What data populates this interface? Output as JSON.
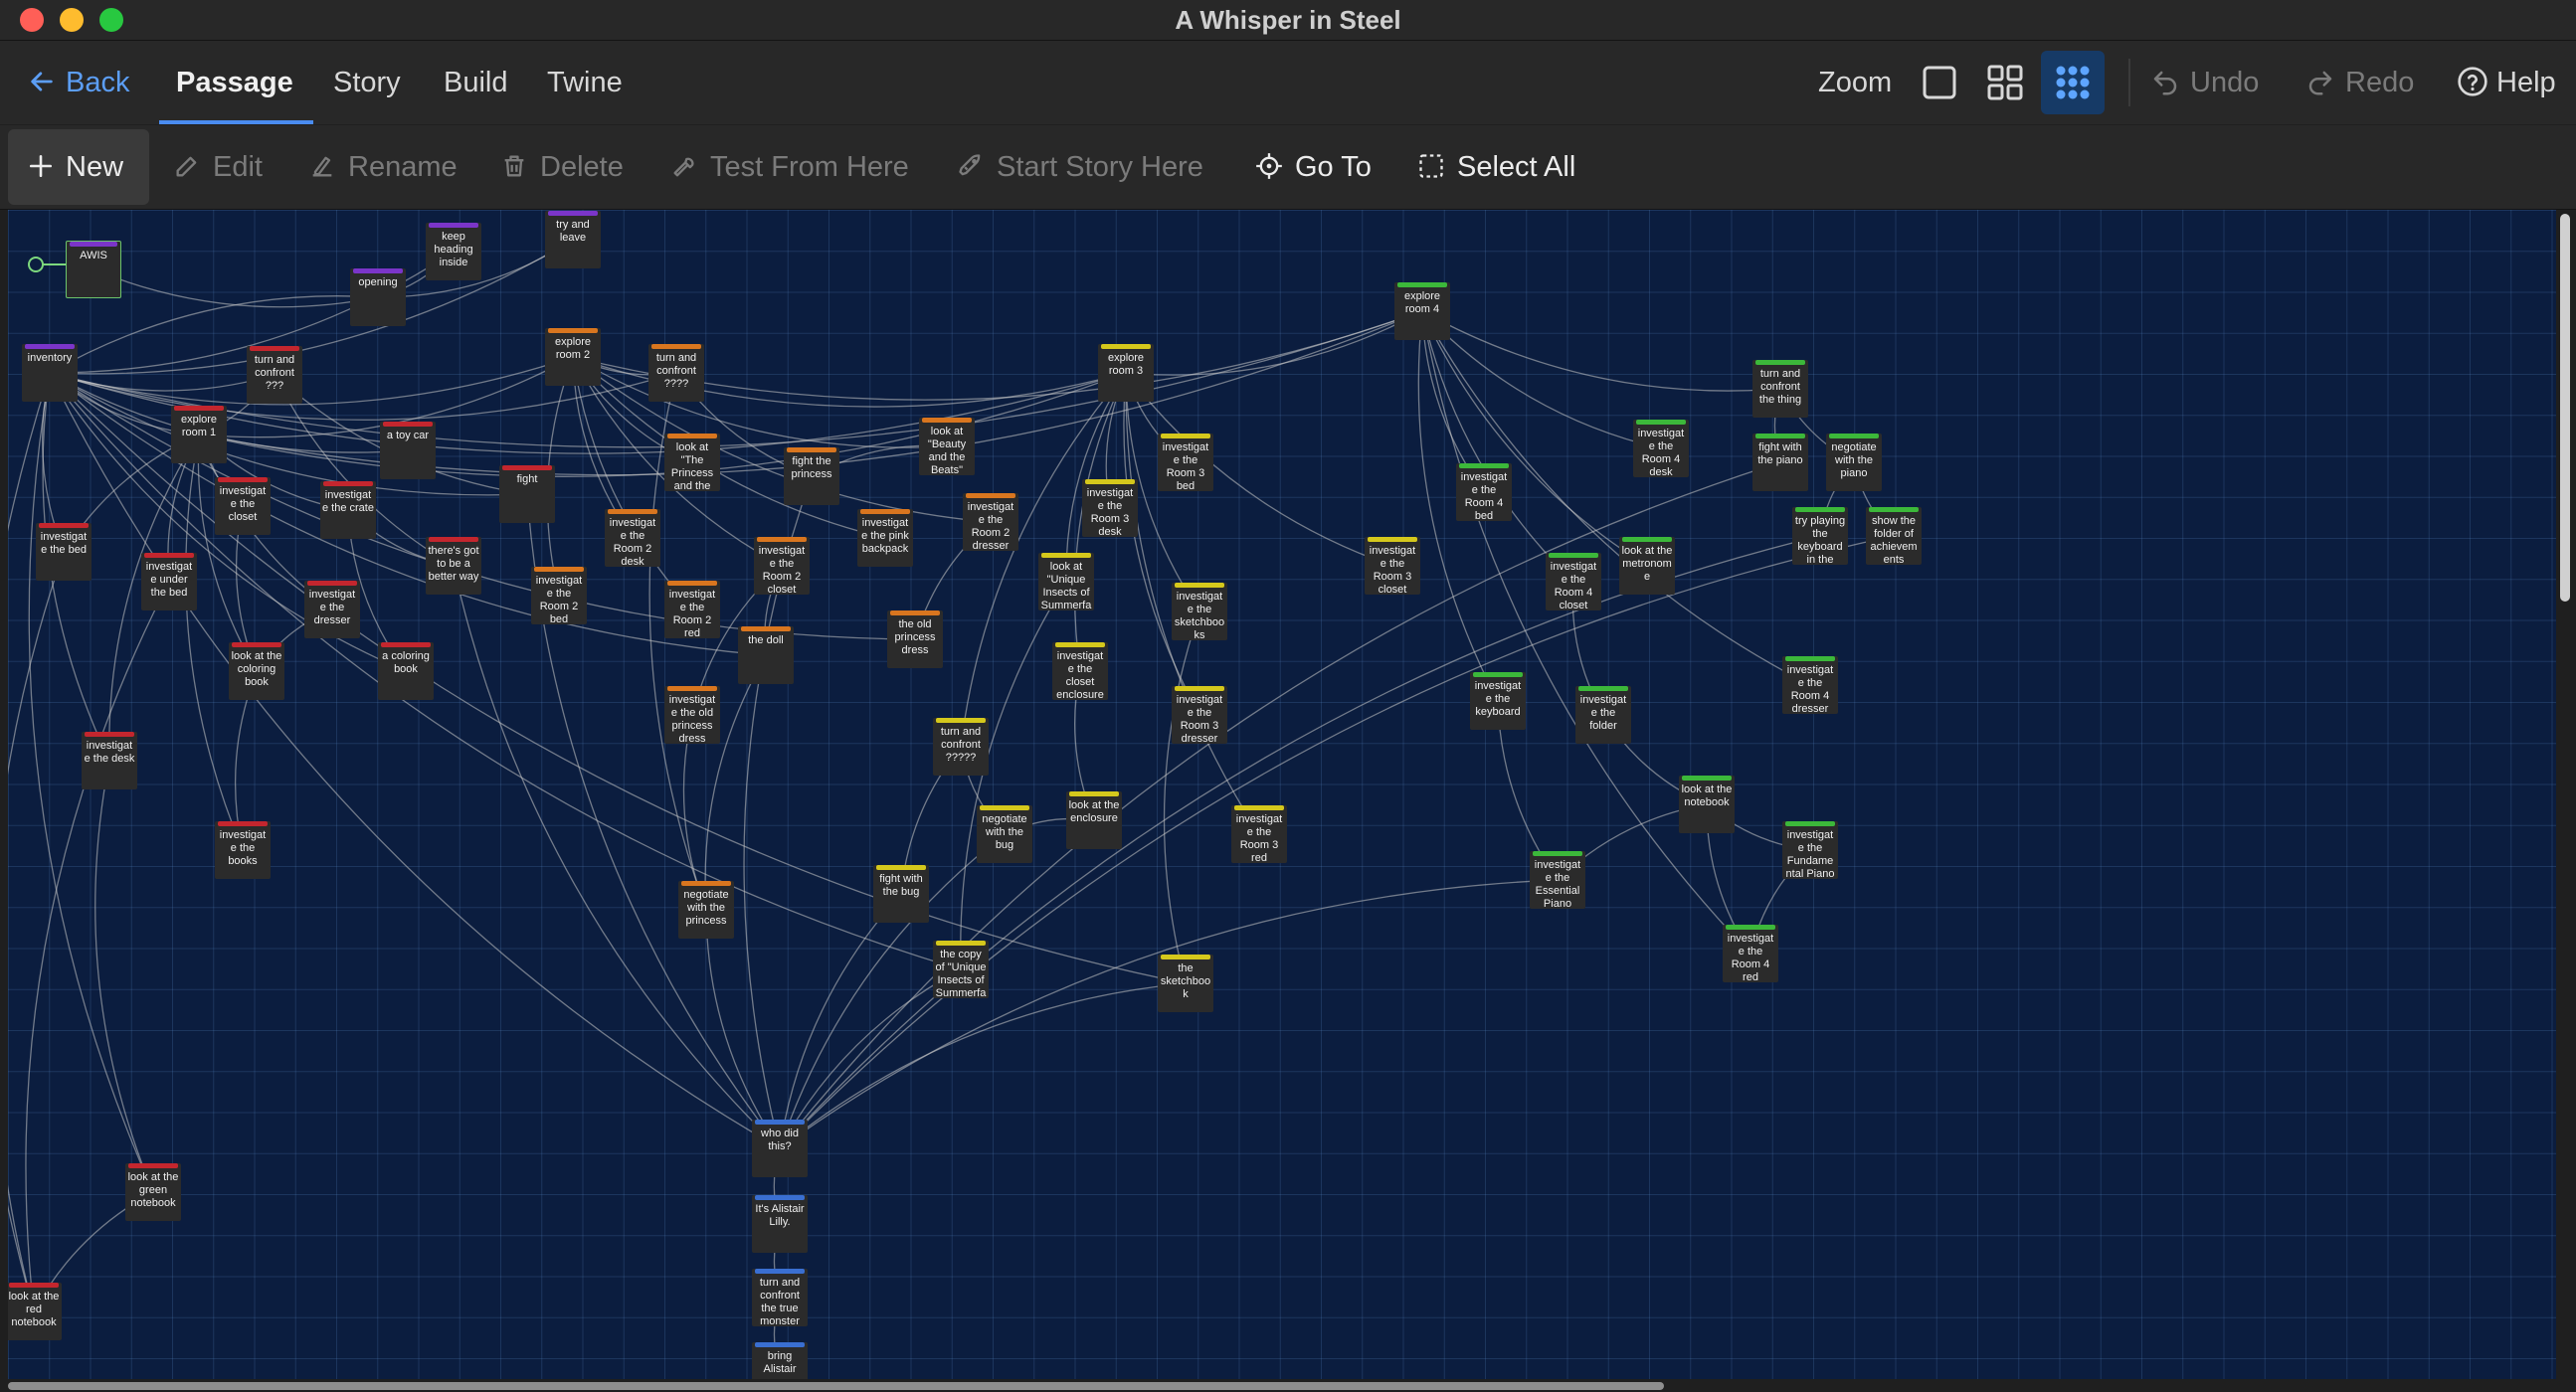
{
  "window": {
    "title": "A Whisper in Steel",
    "colors": {
      "close": "#ff5f57",
      "minimize": "#febc2e",
      "maximize": "#28c840"
    }
  },
  "nav": {
    "back": "Back",
    "tabs": [
      {
        "label": "Passage",
        "active": true
      },
      {
        "label": "Story"
      },
      {
        "label": "Build"
      },
      {
        "label": "Twine"
      }
    ],
    "zoom_label": "Zoom",
    "undo": "Undo",
    "redo": "Redo",
    "help": "Help"
  },
  "toolbar": {
    "new": "New",
    "edit": "Edit",
    "rename": "Rename",
    "delete": "Delete",
    "test_from_here": "Test From Here",
    "start_story_here": "Start Story Here",
    "go_to": "Go To",
    "select_all": "Select All"
  },
  "tag_colors": {
    "purple": "#7b35c9",
    "red": "#c4262e",
    "orange": "#d9761f",
    "yellow": "#d5c81c",
    "green": "#3cb83a",
    "blue": "#3a6fd1"
  },
  "passages": [
    {
      "id": "awis",
      "name": "AWIS",
      "tag": "purple",
      "start": true
    },
    {
      "id": "keep-heading",
      "name": "keep heading inside",
      "tag": "purple"
    },
    {
      "id": "try-leave",
      "name": "try and leave",
      "tag": "purple"
    },
    {
      "id": "opening",
      "name": "opening",
      "tag": "purple"
    },
    {
      "id": "inventory",
      "name": "inventory",
      "tag": "purple"
    },
    {
      "id": "confront-1",
      "name": "turn and confront ???",
      "tag": "red"
    },
    {
      "id": "room1",
      "name": "explore room 1",
      "tag": "red"
    },
    {
      "id": "toy-car",
      "name": "a toy car",
      "tag": "red"
    },
    {
      "id": "fight",
      "name": "fight",
      "tag": "red"
    },
    {
      "id": "inv-bed",
      "name": "investigate the bed",
      "tag": "red"
    },
    {
      "id": "inv-closet1",
      "name": "investigate the closet",
      "tag": "red"
    },
    {
      "id": "inv-crate",
      "name": "investigate the crate",
      "tag": "red"
    },
    {
      "id": "better-way",
      "name": "there's got to be a better way",
      "tag": "red"
    },
    {
      "id": "under-bed",
      "name": "investigate under the bed",
      "tag": "red"
    },
    {
      "id": "inv-dresser1",
      "name": "investigate the dresser",
      "tag": "red"
    },
    {
      "id": "coloring-look",
      "name": "look at the coloring book",
      "tag": "red"
    },
    {
      "id": "coloring-book",
      "name": "a coloring book",
      "tag": "red"
    },
    {
      "id": "inv-desk",
      "name": "investigate the desk",
      "tag": "red"
    },
    {
      "id": "inv-books",
      "name": "investigate the books",
      "tag": "red"
    },
    {
      "id": "green-notebook",
      "name": "look at the green notebook",
      "tag": "red"
    },
    {
      "id": "red-notebook",
      "name": "look at the red notebook",
      "tag": "red"
    },
    {
      "id": "room2",
      "name": "explore room 2",
      "tag": "orange"
    },
    {
      "id": "confront-2",
      "name": "turn and confront ????",
      "tag": "orange"
    },
    {
      "id": "princess-look",
      "name": "look at \"The Princess and the Pea\"",
      "tag": "orange"
    },
    {
      "id": "fight-princess",
      "name": "fight the princess",
      "tag": "orange"
    },
    {
      "id": "beauty",
      "name": "look at \"Beauty and the Beats\"",
      "tag": "orange"
    },
    {
      "id": "r2-desk",
      "name": "investigate the Room 2 desk",
      "tag": "orange"
    },
    {
      "id": "r2-bed",
      "name": "investigate the Room 2 bed",
      "tag": "orange"
    },
    {
      "id": "r2-red",
      "name": "investigate the Room 2 red",
      "tag": "orange"
    },
    {
      "id": "r2-closet",
      "name": "investigate the Room 2 closet",
      "tag": "orange"
    },
    {
      "id": "pink-backpack",
      "name": "investigate the pink backpack",
      "tag": "orange"
    },
    {
      "id": "r2-dresser",
      "name": "investigate the Room 2 dresser",
      "tag": "orange"
    },
    {
      "id": "doll",
      "name": "the doll",
      "tag": "orange"
    },
    {
      "id": "old-dress",
      "name": "the old princess dress",
      "tag": "orange"
    },
    {
      "id": "inv-old-dress",
      "name": "investigate the old princess dress",
      "tag": "orange"
    },
    {
      "id": "negotiate-princess",
      "name": "negotiate with the princess",
      "tag": "orange"
    },
    {
      "id": "room3",
      "name": "explore room 3",
      "tag": "yellow"
    },
    {
      "id": "r3-bed",
      "name": "investigate the Room 3 bed",
      "tag": "yellow"
    },
    {
      "id": "r3-desk",
      "name": "investigate the Room 3 desk",
      "tag": "yellow"
    },
    {
      "id": "unique-insects",
      "name": "look at \"Unique Insects of Summerfall\"",
      "tag": "yellow"
    },
    {
      "id": "sketchbooks",
      "name": "investigate the sketchbooks",
      "tag": "yellow"
    },
    {
      "id": "closet-enclosure",
      "name": "investigate the closet enclosure",
      "tag": "yellow"
    },
    {
      "id": "r3-dresser",
      "name": "investigate the Room 3 dresser",
      "tag": "yellow"
    },
    {
      "id": "r3-closet",
      "name": "investigate the Room 3 closet",
      "tag": "yellow"
    },
    {
      "id": "confront-3",
      "name": "turn and confront ?????",
      "tag": "yellow"
    },
    {
      "id": "negotiate-bug",
      "name": "negotiate with the bug",
      "tag": "yellow"
    },
    {
      "id": "look-enclosure",
      "name": "look at the enclosure",
      "tag": "yellow"
    },
    {
      "id": "r3-red",
      "name": "investigate the Room 3 red",
      "tag": "yellow"
    },
    {
      "id": "fight-bug",
      "name": "fight with the bug",
      "tag": "yellow"
    },
    {
      "id": "copy-insects",
      "name": "the copy of \"Unique Insects of Summerfall\"",
      "tag": "yellow"
    },
    {
      "id": "sketchbook",
      "name": "the sketchbook",
      "tag": "yellow"
    },
    {
      "id": "room4",
      "name": "explore room 4",
      "tag": "green"
    },
    {
      "id": "confront-thing",
      "name": "turn and confront the thing",
      "tag": "green"
    },
    {
      "id": "r4-desk",
      "name": "investigate the Room 4 desk",
      "tag": "green"
    },
    {
      "id": "fight-piano",
      "name": "fight with the piano",
      "tag": "green"
    },
    {
      "id": "negotiate-piano",
      "name": "negotiate with the piano",
      "tag": "green"
    },
    {
      "id": "r4-bed",
      "name": "investigate the Room 4 bed",
      "tag": "green"
    },
    {
      "id": "try-keyboard",
      "name": "try playing the keyboard in the",
      "tag": "green"
    },
    {
      "id": "achievements",
      "name": "show the folder of achievements",
      "tag": "green"
    },
    {
      "id": "metronome",
      "name": "look at the metronome",
      "tag": "green"
    },
    {
      "id": "r4-closet",
      "name": "investigate the Room 4 closet",
      "tag": "green"
    },
    {
      "id": "inv-keyboard",
      "name": "investigate the keyboard",
      "tag": "green"
    },
    {
      "id": "inv-folder",
      "name": "investigate the folder",
      "tag": "green"
    },
    {
      "id": "r4-dresser",
      "name": "investigate the Room 4 dresser",
      "tag": "green"
    },
    {
      "id": "look-notebook",
      "name": "look at the notebook",
      "tag": "green"
    },
    {
      "id": "essential-piano",
      "name": "investigate the Essential Piano",
      "tag": "green"
    },
    {
      "id": "fundamental-piano",
      "name": "investigate the Fundamental Piano",
      "tag": "green"
    },
    {
      "id": "r4-red",
      "name": "investigate the Room 4 red",
      "tag": "green"
    },
    {
      "id": "who-did",
      "name": "who did this?",
      "tag": "blue"
    },
    {
      "id": "alistair",
      "name": "It's Alistair Lilly.",
      "tag": "blue"
    },
    {
      "id": "true-monster",
      "name": "turn and confront the true monster",
      "tag": "blue"
    },
    {
      "id": "bring-alistair",
      "name": "bring Alistair",
      "tag": "blue"
    }
  ],
  "links": [
    [
      "awis",
      "opening"
    ],
    [
      "opening",
      "keep-heading"
    ],
    [
      "opening",
      "try-leave"
    ],
    [
      "opening",
      "inventory"
    ],
    [
      "inventory",
      "room1"
    ],
    [
      "inventory",
      "room2"
    ],
    [
      "inventory",
      "room3"
    ],
    [
      "inventory",
      "room4"
    ],
    [
      "inventory",
      "confront-1"
    ],
    [
      "inventory",
      "confront-2"
    ],
    [
      "inventory",
      "toy-car"
    ],
    [
      "inventory",
      "fight"
    ],
    [
      "inventory",
      "inv-bed"
    ],
    [
      "inventory",
      "inv-desk"
    ],
    [
      "inventory",
      "red-notebook"
    ],
    [
      "inventory",
      "green-notebook"
    ],
    [
      "inventory",
      "keep-heading"
    ],
    [
      "inventory",
      "try-leave"
    ],
    [
      "inventory",
      "coloring-book"
    ],
    [
      "inventory",
      "doll"
    ],
    [
      "inventory",
      "old-dress"
    ],
    [
      "inventory",
      "sketchbook"
    ],
    [
      "inventory",
      "copy-insects"
    ],
    [
      "inventory",
      "who-did"
    ],
    [
      "room1",
      "inv-bed"
    ],
    [
      "room1",
      "inv-closet1"
    ],
    [
      "room1",
      "inv-crate"
    ],
    [
      "room1",
      "under-bed"
    ],
    [
      "room1",
      "inv-dresser1"
    ],
    [
      "room1",
      "inv-desk"
    ],
    [
      "room1",
      "inv-books"
    ],
    [
      "room1",
      "coloring-look"
    ],
    [
      "room1",
      "confront-1"
    ],
    [
      "room1",
      "room2"
    ],
    [
      "room1",
      "room3"
    ],
    [
      "room1",
      "room4"
    ],
    [
      "inv-closet1",
      "coloring-look"
    ],
    [
      "inv-crate",
      "better-way"
    ],
    [
      "inv-crate",
      "coloring-book"
    ],
    [
      "inv-dresser1",
      "coloring-look"
    ],
    [
      "coloring-look",
      "inv-books"
    ],
    [
      "inv-desk",
      "green-notebook"
    ],
    [
      "green-notebook",
      "red-notebook"
    ],
    [
      "inv-bed",
      "red-notebook"
    ],
    [
      "under-bed",
      "red-notebook"
    ],
    [
      "confront-1",
      "fight"
    ],
    [
      "confront-1",
      "better-way"
    ],
    [
      "fight",
      "who-did"
    ],
    [
      "better-way",
      "who-did"
    ],
    [
      "room2",
      "r2-desk"
    ],
    [
      "room2",
      "r2-bed"
    ],
    [
      "room2",
      "r2-red"
    ],
    [
      "room2",
      "r2-closet"
    ],
    [
      "room2",
      "pink-backpack"
    ],
    [
      "room2",
      "r2-dresser"
    ],
    [
      "room2",
      "confront-2"
    ],
    [
      "room2",
      "princess-look"
    ],
    [
      "room2",
      "beauty"
    ],
    [
      "room2",
      "room3"
    ],
    [
      "room2",
      "room4"
    ],
    [
      "confront-2",
      "fight-princess"
    ],
    [
      "confront-2",
      "negotiate-princess"
    ],
    [
      "r2-closet",
      "inv-old-dress"
    ],
    [
      "r2-closet",
      "doll"
    ],
    [
      "r2-dresser",
      "old-dress"
    ],
    [
      "beauty",
      "fight-princess"
    ],
    [
      "fight-princess",
      "who-did"
    ],
    [
      "negotiate-princess",
      "who-did"
    ],
    [
      "inv-old-dress",
      "negotiate-princess"
    ],
    [
      "doll",
      "negotiate-princess"
    ],
    [
      "room3",
      "r3-bed"
    ],
    [
      "room3",
      "r3-desk"
    ],
    [
      "room3",
      "unique-insects"
    ],
    [
      "room3",
      "sketchbooks"
    ],
    [
      "room3",
      "closet-enclosure"
    ],
    [
      "room3",
      "r3-dresser"
    ],
    [
      "room3",
      "r3-closet"
    ],
    [
      "room3",
      "confront-3"
    ],
    [
      "room3",
      "r3-red"
    ],
    [
      "room3",
      "room4"
    ],
    [
      "confront-3",
      "negotiate-bug"
    ],
    [
      "confront-3",
      "fight-bug"
    ],
    [
      "closet-enclosure",
      "look-enclosure"
    ],
    [
      "unique-insects",
      "copy-insects"
    ],
    [
      "sketchbooks",
      "sketchbook"
    ],
    [
      "look-enclosure",
      "negotiate-bug"
    ],
    [
      "fight-bug",
      "who-did"
    ],
    [
      "negotiate-bug",
      "who-did"
    ],
    [
      "copy-insects",
      "who-did"
    ],
    [
      "sketchbook",
      "who-did"
    ],
    [
      "room4",
      "confront-thing"
    ],
    [
      "room4",
      "r4-desk"
    ],
    [
      "room4",
      "r4-bed"
    ],
    [
      "room4",
      "r4-closet"
    ],
    [
      "room4",
      "metronome"
    ],
    [
      "room4",
      "r4-dresser"
    ],
    [
      "room4",
      "r4-red"
    ],
    [
      "room4",
      "inv-keyboard"
    ],
    [
      "confront-thing",
      "fight-piano"
    ],
    [
      "confront-thing",
      "negotiate-piano"
    ],
    [
      "negotiate-piano",
      "try-keyboard"
    ],
    [
      "negotiate-piano",
      "achievements"
    ],
    [
      "r4-closet",
      "inv-folder"
    ],
    [
      "inv-folder",
      "look-notebook"
    ],
    [
      "inv-keyboard",
      "essential-piano"
    ],
    [
      "look-notebook",
      "fundamental-piano"
    ],
    [
      "look-notebook",
      "essential-piano"
    ],
    [
      "look-notebook",
      "r4-red"
    ],
    [
      "fundamental-piano",
      "r4-red"
    ],
    [
      "essential-piano",
      "who-did"
    ],
    [
      "fight-piano",
      "who-did"
    ],
    [
      "try-keyboard",
      "who-did"
    ],
    [
      "achievements",
      "who-did"
    ],
    [
      "who-did",
      "alistair"
    ],
    [
      "alistair",
      "true-monster"
    ],
    [
      "true-monster",
      "bring-alistair"
    ]
  ]
}
